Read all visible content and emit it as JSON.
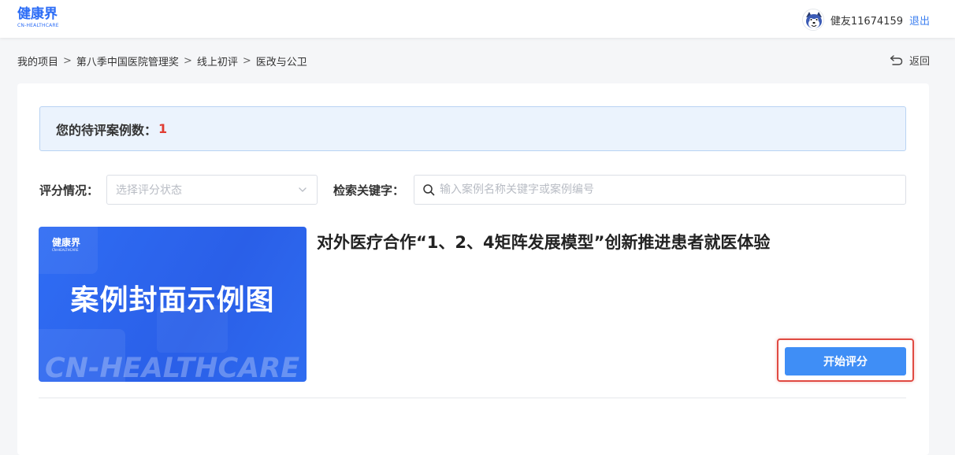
{
  "header": {
    "logo_cn": "健康界",
    "logo_en": "CN-HEALTHCARE",
    "username": "健友11674159",
    "logout_label": "退出"
  },
  "breadcrumb": {
    "items": [
      "我的项目",
      "第八季中国医院管理奖",
      "线上初评",
      "医改与公卫"
    ],
    "separator": ">"
  },
  "back_label": "返回",
  "pending": {
    "label": "您的待评案例数：",
    "count": "1"
  },
  "filters": {
    "status_label": "评分情况：",
    "status_placeholder": "选择评分状态",
    "keyword_label": "检索关键字：",
    "keyword_placeholder": "输入案例名称关键字或案例编号"
  },
  "case": {
    "cover_logo_cn": "健康界",
    "cover_logo_en": "CN-HEALTHCARE",
    "cover_title": "案例封面示例图",
    "cover_watermark": "CN-HEALTHCARE",
    "title": "对外医疗合作“1、2、4矩阵发展模型”创新推进患者就医体验",
    "start_button": "开始评分"
  },
  "colors": {
    "brand": "#2b6cf6",
    "count_red": "#e03c32",
    "button_blue": "#3f8ef6",
    "highlight_red": "#e04a42"
  }
}
